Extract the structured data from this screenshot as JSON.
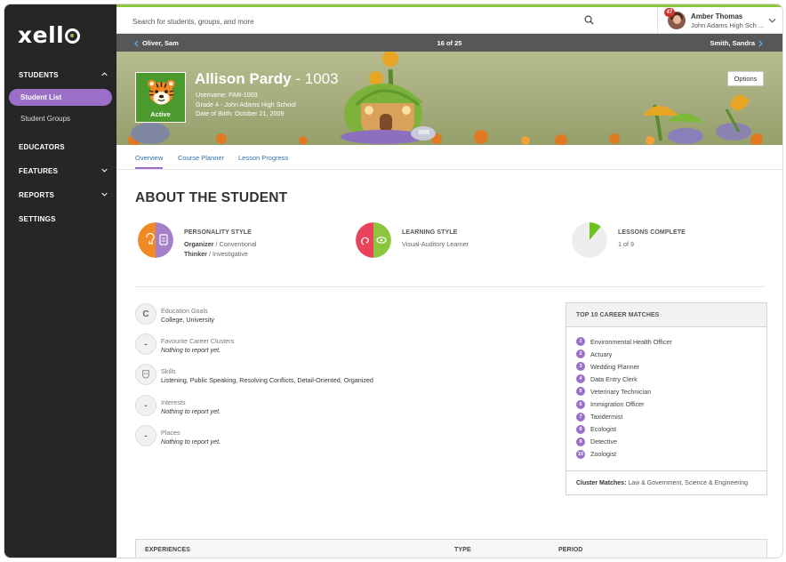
{
  "app": {
    "logo_text": "xell"
  },
  "sidebar": {
    "items": [
      {
        "label": "STUDENTS",
        "expanded": true
      },
      {
        "label": "Student List",
        "active": true
      },
      {
        "label": "Student Groups"
      },
      {
        "label": "EDUCATORS"
      },
      {
        "label": "FEATURES"
      },
      {
        "label": "REPORTS"
      },
      {
        "label": "SETTINGS"
      }
    ]
  },
  "header": {
    "search_placeholder": "Search for students, groups, and more",
    "user": {
      "name": "Amber Thomas",
      "school": "John Adams High Sch ...",
      "notifications": "47"
    }
  },
  "pager": {
    "prev": "Oliver, Sam",
    "position": "16 of 25",
    "next": "Smith, Sandra"
  },
  "student": {
    "name": "Allison Pardy",
    "id_suffix": " - 1003",
    "status": "Active",
    "username": "Username: PAR-1003",
    "grade_school": "Grade 4 - John Adams High School",
    "dob": "Date of Birth: October 21, 2009",
    "options_label": "Options"
  },
  "tabs": [
    {
      "label": "Overview",
      "active": true
    },
    {
      "label": "Course Planner"
    },
    {
      "label": "Lesson Progress"
    }
  ],
  "about": {
    "title_bold": "ABOUT",
    "title_rest": " THE STUDENT",
    "personality": {
      "label": "PERSONALITY STYLE",
      "line1_bold": "Organizer",
      "line1_rest": " / Conventional",
      "line2_bold": "Thinker",
      "line2_rest": " / Investigative",
      "colors": [
        "#f08a24",
        "#a580c9"
      ]
    },
    "learning": {
      "label": "LEARNING STYLE",
      "value": "Visual-Auditory Learner",
      "colors": [
        "#e8435a",
        "#8cc63f"
      ]
    },
    "lessons": {
      "label": "LESSONS COMPLETE",
      "value": "1 of 9",
      "completed": 1,
      "total": 9,
      "color": "#6cc320"
    }
  },
  "profile": [
    {
      "icon": "C",
      "title": "Education Goals",
      "value": "College, University",
      "empty": false
    },
    {
      "icon": "-",
      "title": "Favourite Career Clusters",
      "value": "Nothing to report yet.",
      "empty": true
    },
    {
      "icon": "",
      "title": "Skills",
      "value": "Listening, Public Speaking, Resolving Conflicts, Detail-Oriented, Organized",
      "empty": false
    },
    {
      "icon": "-",
      "title": "Interests",
      "value": "Nothing to report yet.",
      "empty": true
    },
    {
      "icon": "-",
      "title": "Places",
      "value": "Nothing to report yet.",
      "empty": true
    }
  ],
  "careers": {
    "title": "TOP 10 CAREER MATCHES",
    "items": [
      "Environmental Health Officer",
      "Actuary",
      "Wedding Planner",
      "Data Entry Clerk",
      "Veterinary Technician",
      "Immigration Officer",
      "Taxidermist",
      "Ecologist",
      "Detective",
      "Zoologist"
    ],
    "cluster_label": "Cluster Matches:",
    "cluster_value": " Law & Government, Science & Engineering"
  },
  "experiences": {
    "columns": [
      "EXPERIENCES",
      "TYPE",
      "PERIOD"
    ]
  },
  "colors": {
    "accent": "#9b6fc8",
    "sidebar": "#262626",
    "link": "#2f6fa7",
    "green": "#8cc63f"
  }
}
